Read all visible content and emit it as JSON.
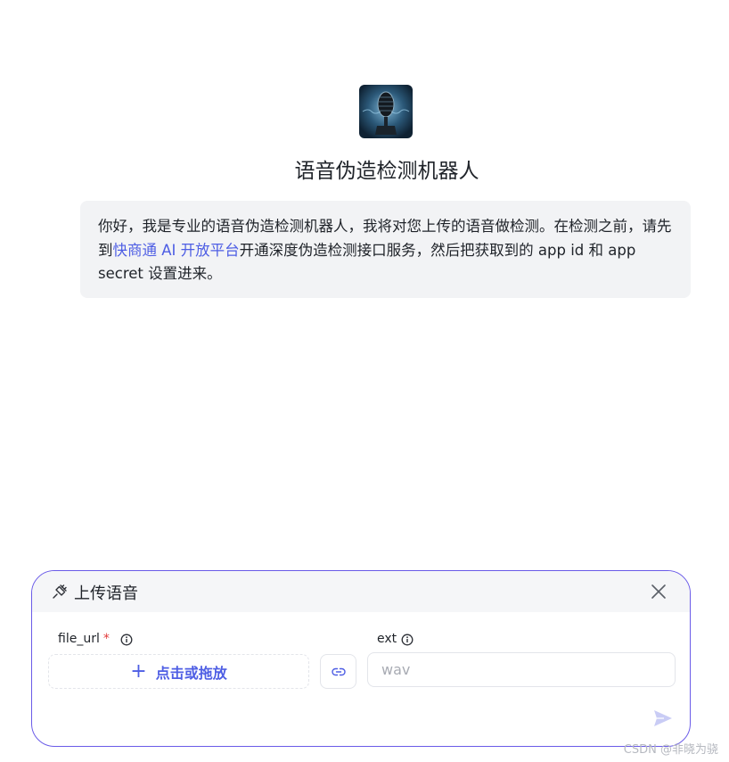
{
  "bot": {
    "avatar_icon": "microphone-icon",
    "name": "语音伪造检测机器人"
  },
  "greeting": {
    "text_before": "你好，我是专业的语音伪造检测机器人，我将对您上传的语音做检测。在检测之前，请先到",
    "link_text": "快商通 AI 开放平台",
    "text_after": "开通深度伪造检测接口服务，然后把获取到的 app id 和 app secret 设置进来。"
  },
  "upload_panel": {
    "title": "上传语音",
    "title_icon": "plugin-icon",
    "close_icon": "close-icon",
    "file_url": {
      "label": "file_url",
      "required_mark": "*",
      "info_icon": "info-icon",
      "drop_label": "点击或拖放",
      "drop_icon": "plus-icon",
      "link_icon": "link-icon"
    },
    "ext": {
      "label": "ext",
      "info_icon": "info-icon",
      "placeholder": "wav",
      "value": ""
    },
    "send_icon": "send-icon"
  },
  "watermark": "CSDN @非晓为骁",
  "colors": {
    "accent": "#4e5ee4",
    "panel_border": "#6a5be8",
    "bubble_bg": "#f2f3f5",
    "required": "#e23a3a"
  }
}
